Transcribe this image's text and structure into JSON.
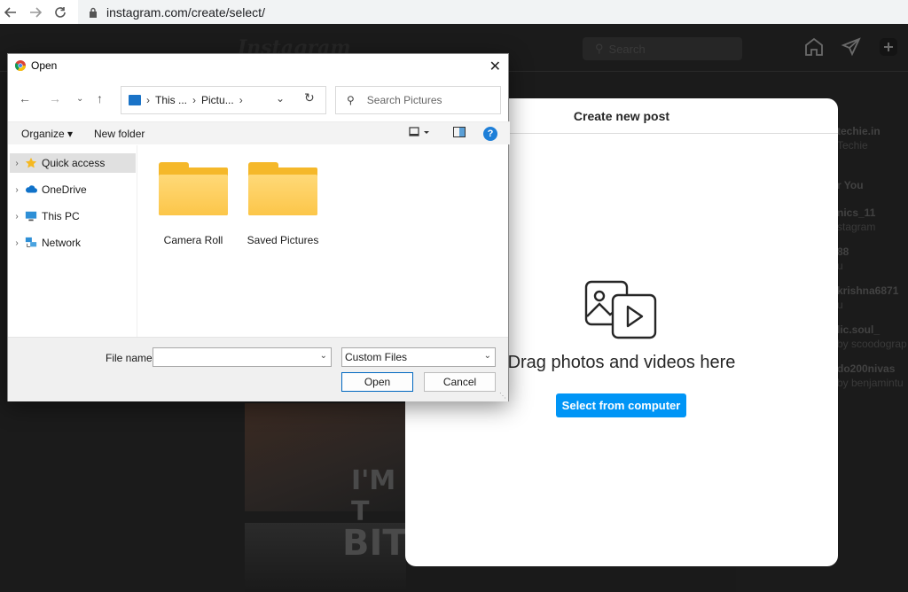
{
  "browser": {
    "url": "instagram.com/create/select/",
    "back_icon": "arrow-left-icon",
    "forward_icon": "arrow-right-icon",
    "reload_icon": "reload-icon"
  },
  "instagram": {
    "logo_text": "Instagram",
    "search_placeholder": "Search",
    "suggestions": [
      {
        "name": "techie.in",
        "sub": "Techie"
      },
      {
        "name": "r You",
        "sub": ""
      },
      {
        "name": "nics_11",
        "sub": "stagram"
      },
      {
        "name": "88",
        "sub": "u"
      },
      {
        "name": "krishna6871",
        "sub": "u"
      },
      {
        "name": "lic.soul_",
        "sub": "by scoodograp"
      },
      {
        "name": "do200nivas",
        "sub": "by benjamintu"
      }
    ],
    "feed_text_1": "I'M T",
    "feed_text_2": "BIT"
  },
  "modal": {
    "title": "Create new post",
    "drag_text": "Drag photos and videos here",
    "select_button": "Select from computer"
  },
  "dialog": {
    "title": "Open",
    "breadcrumb": [
      "This ...",
      "Pictu..."
    ],
    "search_placeholder": "Search Pictures",
    "toolbar": {
      "organize": "Organize",
      "new_folder": "New folder",
      "help": "?"
    },
    "nav_items": [
      {
        "label": "Quick access",
        "selected": true
      },
      {
        "label": "OneDrive",
        "selected": false
      },
      {
        "label": "This PC",
        "selected": false
      },
      {
        "label": "Network",
        "selected": false
      }
    ],
    "folders": [
      "Camera Roll",
      "Saved Pictures"
    ],
    "footer": {
      "file_name_label": "File name:",
      "file_name_value": "",
      "filter": "Custom Files",
      "open_button": "Open",
      "cancel_button": "Cancel"
    }
  },
  "colors": {
    "ig_blue": "#0095f6",
    "folder_yellow": "#fcc649",
    "win_accent": "#0067c0"
  }
}
